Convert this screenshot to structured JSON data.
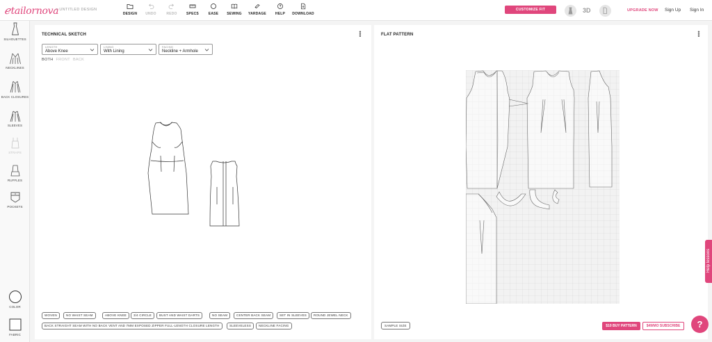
{
  "app": {
    "logo": "tailornova",
    "breadcrumb": "> UNTITLED DESIGN"
  },
  "toolbar": {
    "tools": [
      {
        "label": "DESIGN",
        "icon": "folder-icon",
        "enabled": true
      },
      {
        "label": "UNDO",
        "icon": "undo-icon",
        "enabled": false
      },
      {
        "label": "REDO",
        "icon": "redo-icon",
        "enabled": false
      },
      {
        "label": "SPECS",
        "icon": "ruler-icon",
        "enabled": true
      },
      {
        "label": "EASE",
        "icon": "circle-icon",
        "enabled": true
      },
      {
        "label": "SEWING",
        "icon": "book-icon",
        "enabled": true
      },
      {
        "label": "YARDAGE",
        "icon": "fabric-roll-icon",
        "enabled": true
      },
      {
        "label": "HELP",
        "icon": "help-icon",
        "enabled": true
      },
      {
        "label": "DOWNLOAD",
        "icon": "download-icon",
        "enabled": true
      }
    ],
    "customize_fit": "CUSTOMIZE FIT",
    "view_3d": "3D",
    "upgrade": "UPGRADE NOW",
    "sign_up": "Sign Up",
    "sign_in": "Sign In"
  },
  "sidebar": {
    "items": [
      {
        "label": "SILHOUETTES",
        "icon": "silhouette-icon",
        "enabled": true
      },
      {
        "label": "NECKLINES",
        "icon": "neckline-icon",
        "enabled": true
      },
      {
        "label": "BACK CLOSURES",
        "icon": "back-closure-icon",
        "enabled": true
      },
      {
        "label": "SLEEVES",
        "icon": "sleeve-icon",
        "enabled": true
      },
      {
        "label": "STRAPS",
        "icon": "strap-icon",
        "enabled": false
      },
      {
        "label": "RUFFLES",
        "icon": "ruffle-icon",
        "enabled": true
      },
      {
        "label": "POCKETS",
        "icon": "pocket-icon",
        "enabled": true
      }
    ],
    "color_label": "COLOR",
    "fabric_label": "FABRIC"
  },
  "sketch": {
    "title": "TECHNICAL SKETCH",
    "selects": [
      {
        "label": "LENGTH",
        "value": "Above Knee"
      },
      {
        "label": "LINING",
        "value": "With Lining"
      },
      {
        "label": "FACING",
        "value": "Neckline + Armhole"
      }
    ],
    "views": [
      "BOTH",
      "FRONT",
      "BACK"
    ],
    "active_view": "BOTH",
    "tags": [
      "WOVEN",
      "NO WAIST SEAM",
      "ABOVE KNEE",
      "3/4 CIRCLE",
      "BUST AND WAIST DARTS",
      "NO SEAM",
      "CENTER BACK SEAM",
      "SET IN SLEEVES",
      "ROUND JEWEL NECK",
      "BACK STRAIGHT SEAM WITH NO BACK VENT AND 7MM EXPOSED ZIPPER FULL-LENGTH CLOSURE LENGTH",
      "SLEEVELESS",
      "NECKLINE FACING"
    ]
  },
  "pattern": {
    "title": "FLAT PATTERN",
    "sample_size": "SAMPLE SIZE",
    "buy": "$10 BUY PATTERN",
    "subscribe": "$49/MO SUBSCRIBE"
  },
  "help": {
    "lessons": "Help lessons",
    "question": "?"
  },
  "colors": {
    "accent": "#e0467c",
    "panel": "#ffffff",
    "background": "#f4f4f4"
  }
}
